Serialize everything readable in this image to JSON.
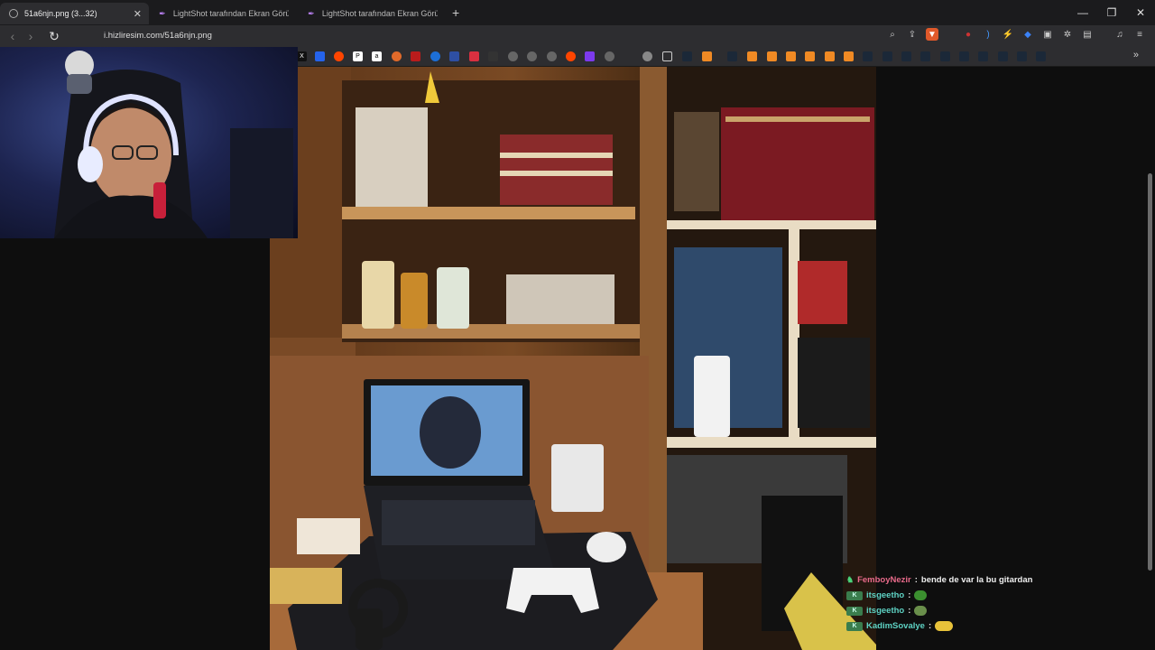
{
  "tabs": [
    {
      "title": "51a6njn.png (3...32)",
      "active": true,
      "close": "✕"
    },
    {
      "title": "LightShot tarafından Ekran Görüntüsü",
      "active": false
    },
    {
      "title": "LightShot tarafından Ekran Görüntüsü",
      "active": false
    }
  ],
  "newtab": "+",
  "window": {
    "minimize": "—",
    "restore": "❐",
    "close": "✕"
  },
  "toolbar": {
    "back": "‹",
    "forward": "›",
    "reload": "↻",
    "url": "i.hizliresim.com/51a6njn.png"
  },
  "bookmarks_more": "»",
  "chat": [
    {
      "user": "FemboyNezir",
      "message": "bende de var la bu gitardan",
      "badge": "",
      "color": "pink",
      "emote": ""
    },
    {
      "user": "itsgeetho",
      "message": "",
      "badge": "K",
      "color": "teal",
      "emote": "#3b8f2f"
    },
    {
      "user": "itsgeetho",
      "message": "",
      "badge": "K",
      "color": "teal",
      "emote": "#6a8f4b"
    },
    {
      "user": "KadimSovalye",
      "message": "",
      "badge": "K",
      "color": "teal",
      "emote": "#e8c23a"
    }
  ]
}
